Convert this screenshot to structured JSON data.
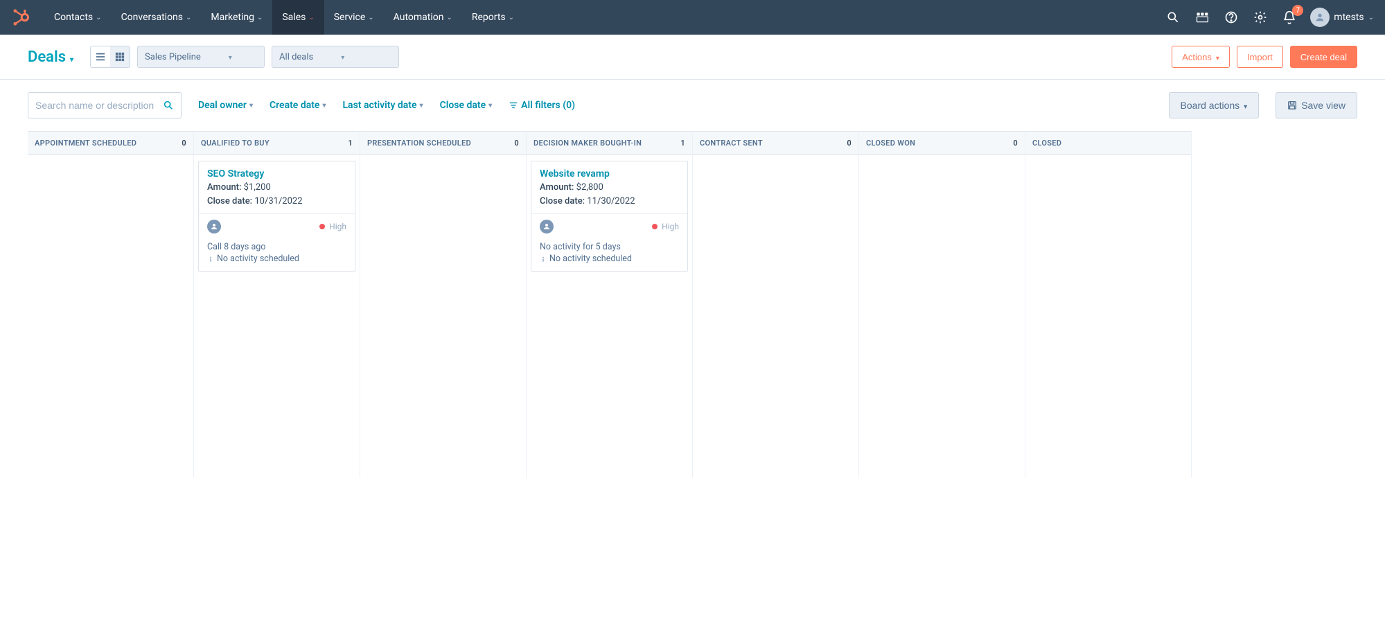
{
  "nav": {
    "items": [
      {
        "label": "Contacts"
      },
      {
        "label": "Conversations"
      },
      {
        "label": "Marketing"
      },
      {
        "label": "Sales"
      },
      {
        "label": "Service"
      },
      {
        "label": "Automation"
      },
      {
        "label": "Reports"
      }
    ],
    "notification_count": "7",
    "username": "mtests"
  },
  "toolbar": {
    "title": "Deals",
    "pipeline": "Sales Pipeline",
    "view_filter": "All deals",
    "actions": "Actions",
    "import": "Import",
    "create": "Create deal"
  },
  "filters": {
    "search_placeholder": "Search name or description",
    "deal_owner": "Deal owner",
    "create_date": "Create date",
    "last_activity": "Last activity date",
    "close_date": "Close date",
    "all_filters": "All filters (0)",
    "board_actions": "Board actions",
    "save_view": "Save view"
  },
  "columns": [
    {
      "title": "APPOINTMENT SCHEDULED",
      "count": "0",
      "cards": []
    },
    {
      "title": "QUALIFIED TO BUY",
      "count": "1",
      "cards": [
        {
          "name": "SEO Strategy",
          "amount_label": "Amount:",
          "amount": "$1,200",
          "close_label": "Close date:",
          "close": "10/31/2022",
          "priority": "High",
          "activity": "Call 8 days ago",
          "warning": "No activity scheduled"
        }
      ]
    },
    {
      "title": "PRESENTATION SCHEDULED",
      "count": "0",
      "cards": []
    },
    {
      "title": "DECISION MAKER BOUGHT-IN",
      "count": "1",
      "cards": [
        {
          "name": "Website revamp",
          "amount_label": "Amount:",
          "amount": "$2,800",
          "close_label": "Close date:",
          "close": "11/30/2022",
          "priority": "High",
          "activity": "No activity for 5 days",
          "warning": "No activity scheduled"
        }
      ]
    },
    {
      "title": "CONTRACT SENT",
      "count": "0",
      "cards": []
    },
    {
      "title": "CLOSED WON",
      "count": "0",
      "cards": []
    },
    {
      "title": "CLOSED",
      "count": "",
      "cards": []
    }
  ]
}
